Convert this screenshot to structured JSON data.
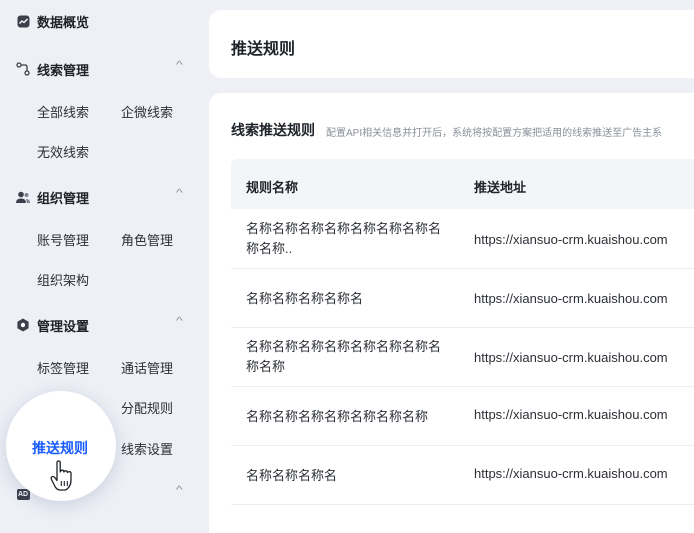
{
  "sidebar": {
    "overview": "数据概览",
    "lead_mgmt": {
      "label": "线索管理",
      "items": [
        "全部线索",
        "企微线索",
        "无效线索"
      ]
    },
    "org_mgmt": {
      "label": "组织管理",
      "items": [
        "账号管理",
        "角色管理",
        "组织架构"
      ]
    },
    "mgmt_settings": {
      "label": "管理设置",
      "items": [
        "标签管理",
        "通话管理",
        "分配规则",
        "推送规则",
        "线索设置"
      ]
    },
    "ad_badge": "AD"
  },
  "header": {
    "title": "推送规则"
  },
  "section": {
    "title": "线索推送规则",
    "description": "配置API相关信息并打开后，系统将按配置方案把适用的线索推送至广告主系"
  },
  "table": {
    "columns": [
      "规则名称",
      "推送地址"
    ],
    "rows": [
      {
        "name": "名称名称名称名称名称名称名称名称名称..",
        "url": "https://xiansuo-crm.kuaishou.com"
      },
      {
        "name": "名称名称名称名称名",
        "url": "https://xiansuo-crm.kuaishou.com"
      },
      {
        "name": "名称名称名称名称名称名称名称名称名称",
        "url": "https://xiansuo-crm.kuaishou.com"
      },
      {
        "name": "名称名称名称名称名称名称名称",
        "url": "https://xiansuo-crm.kuaishou.com"
      },
      {
        "name": "名称名称名称名",
        "url": "https://xiansuo-crm.kuaishou.com"
      }
    ]
  },
  "colors": {
    "accent": "#1a5cff",
    "background": "#eef0f6"
  }
}
